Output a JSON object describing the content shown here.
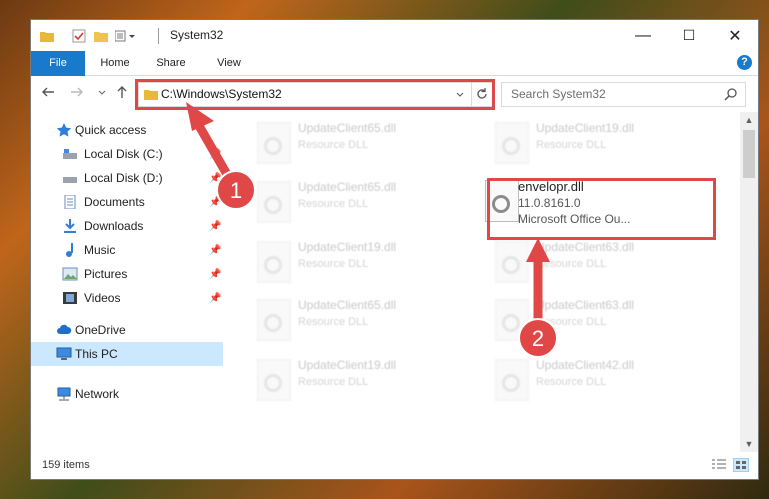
{
  "titlebar": {
    "title": "System32",
    "minimize": "—",
    "maximize": "☐",
    "close": "✕"
  },
  "ribbon": {
    "tabs": [
      "File",
      "Home",
      "Share",
      "View"
    ],
    "help": "?"
  },
  "address": {
    "path": "C:\\Windows\\System32",
    "search_placeholder": "Search System32"
  },
  "nav": {
    "items": [
      {
        "label": "Quick access",
        "icon": "star-icon"
      },
      {
        "label": "Local Disk (C:)",
        "icon": "drive-icon"
      },
      {
        "label": "Local Disk (D:)",
        "icon": "drive-icon"
      },
      {
        "label": "Documents",
        "icon": "document-icon"
      },
      {
        "label": "Downloads",
        "icon": "download-icon"
      },
      {
        "label": "Music",
        "icon": "music-icon"
      },
      {
        "label": "Pictures",
        "icon": "picture-icon"
      },
      {
        "label": "Videos",
        "icon": "video-icon"
      },
      {
        "label": "OneDrive",
        "icon": "cloud-icon"
      },
      {
        "label": "This PC",
        "icon": "computer-icon"
      },
      {
        "label": "Network",
        "icon": "network-icon"
      }
    ]
  },
  "files": [
    {
      "name": "UpdateClient65.dll",
      "type": "Resource DLL"
    },
    {
      "name": "UpdateClient19.dll",
      "type": "Resource DLL"
    },
    {
      "name": "UpdateClient65.dll",
      "type": "Resource DLL"
    },
    {
      "name": "envelopr.dll",
      "type": "11.0.8161.0",
      "desc": "Microsoft Office Ou..."
    },
    {
      "name": "UpdateClient19.dll",
      "type": "Resource DLL"
    },
    {
      "name": "UpdateClient63.dll",
      "type": "Resource DLL"
    },
    {
      "name": "UpdateClient65.dll",
      "type": "Resource DLL"
    },
    {
      "name": "UpdateClient63.dll",
      "type": "Resource DLL"
    },
    {
      "name": "UpdateClient19.dll",
      "type": "Resource DLL"
    },
    {
      "name": "UpdateClient42.dll",
      "type": "Resource DLL"
    }
  ],
  "status": {
    "count": "159 items"
  },
  "annotations": {
    "step1": "1",
    "step2": "2",
    "color": "#e04848"
  }
}
